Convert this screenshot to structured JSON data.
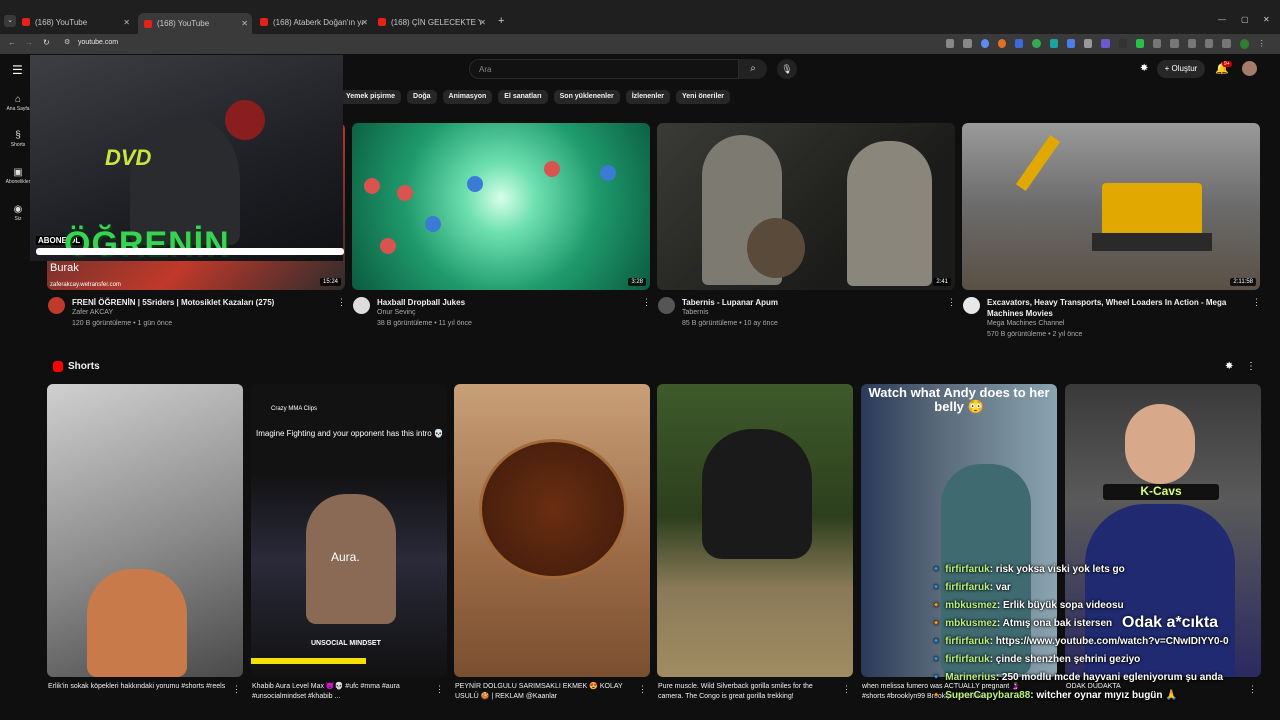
{
  "browser": {
    "tabs": [
      {
        "label": "(168) YouTube"
      },
      {
        "label": "(168) YouTube"
      },
      {
        "label": "(168) Ataberk Doğan'ın yayını"
      },
      {
        "label": "(168) ÇİN GELECEKTE YAŞIYOR"
      }
    ],
    "url": "youtube.com"
  },
  "header": {
    "search_placeholder": "Ara",
    "create_label": "Oluştur",
    "notif_count": "9+"
  },
  "sidebar": {
    "items": [
      {
        "label": "Ana Sayfa",
        "icon": "home-icon"
      },
      {
        "label": "Shorts",
        "icon": "shorts-icon"
      },
      {
        "label": "Abonelikler",
        "icon": "subscriptions-icon"
      },
      {
        "label": "Siz",
        "icon": "user-icon"
      }
    ]
  },
  "chips": [
    "Yemek pişirme",
    "Doğa",
    "Animasyon",
    "El sanatları",
    "Son yüklenenler",
    "İzlenenler",
    "Yeni öneriler"
  ],
  "videos": [
    {
      "title": "FRENİ ÖĞRENİN | 5Sriders | Motosiklet Kazaları (275)",
      "channel": "Zafer AKCAY",
      "meta": "120 B görüntüleme • 1 gün önce",
      "duration": "15:24"
    },
    {
      "title": "Haxball Dropball Jukes",
      "channel": "Onur Sevinç",
      "meta": "38 B görüntüleme • 11 yıl önce",
      "duration": "3:28"
    },
    {
      "title": "Tabernis - Lupanar Apum",
      "channel": "Tabernis",
      "meta": "85 B görüntüleme • 10 ay önce",
      "duration": "2:41"
    },
    {
      "title": "Excavators, Heavy Transports, Wheel Loaders In Action - Mega Machines Movies",
      "channel": "Mega Machines Channel",
      "meta": "570 B görüntüleme • 2 yıl önce",
      "duration": "2:11:58"
    }
  ],
  "overlay_video": {
    "abone": "ABONE OL",
    "big_text": "ÖĞRENİN",
    "name": "Burak",
    "site": "zaferakcay.wetransfer.com"
  },
  "shorts": {
    "title": "Shorts",
    "items": [
      {
        "title": "Erlik'in sokak köpekleri hakkındaki yorumu #shorts #reels"
      },
      {
        "title": "Khabib Aura Level Max 😈💀 #ufc #mma #aura #unsocialmindset #khabib ..."
      },
      {
        "title": "PEYNİR DOLGULU SARIMSAKLI EKMEK 😍 KOLAY USULÜ 🍪 | REKLAM @Kaanlar"
      },
      {
        "title": "Pure muscle.  Wild Silverback gorilla smiles for the camera.  The Congo is great gorilla trekking!"
      },
      {
        "title": "when melissa fumero was ACTUALLY pregnant 🤰 #shorts #brooklyn99 Brooklyn Nine-Nine"
      },
      {
        "title": "ODAK DUDAKTA"
      }
    ],
    "short2_caption": "Imagine Fighting and your opponent has this intro 💀",
    "short2_channel": "Crazy MMA Clips",
    "short2_aura": "Aura.",
    "short2_mindset": "UNSOCIAL MINDSET",
    "short5_caption": "Watch what Andy does to her belly 😳"
  },
  "chat": [
    {
      "user": "firfirfaruk",
      "msg": ": risk yoksa viski yok lets go"
    },
    {
      "user": "firfirfaruk",
      "msg": ": var"
    },
    {
      "user": "mbkusmez",
      "msg": ": Erlik büyük sopa videosu"
    },
    {
      "user": "mbkusmez",
      "msg": ": Atmış ona bak istersen"
    },
    {
      "user": "firfirfaruk",
      "msg": ": https://www.youtube.com/watch?v=CNwIDIYY0-0"
    },
    {
      "user": "firfirfaruk",
      "msg": ": çinde shenzhen şehrini geziyo"
    },
    {
      "user": "Marinerius",
      "msg": ": 250 modlu mcde hayvani egleniyorum şu anda"
    },
    {
      "user": "SuperCapybara88",
      "msg": ": witcher oynar mıyız bugün 🙏"
    }
  ],
  "stream": {
    "kcavs": "K-Cavs",
    "odak": "Odak a*cıkta"
  }
}
